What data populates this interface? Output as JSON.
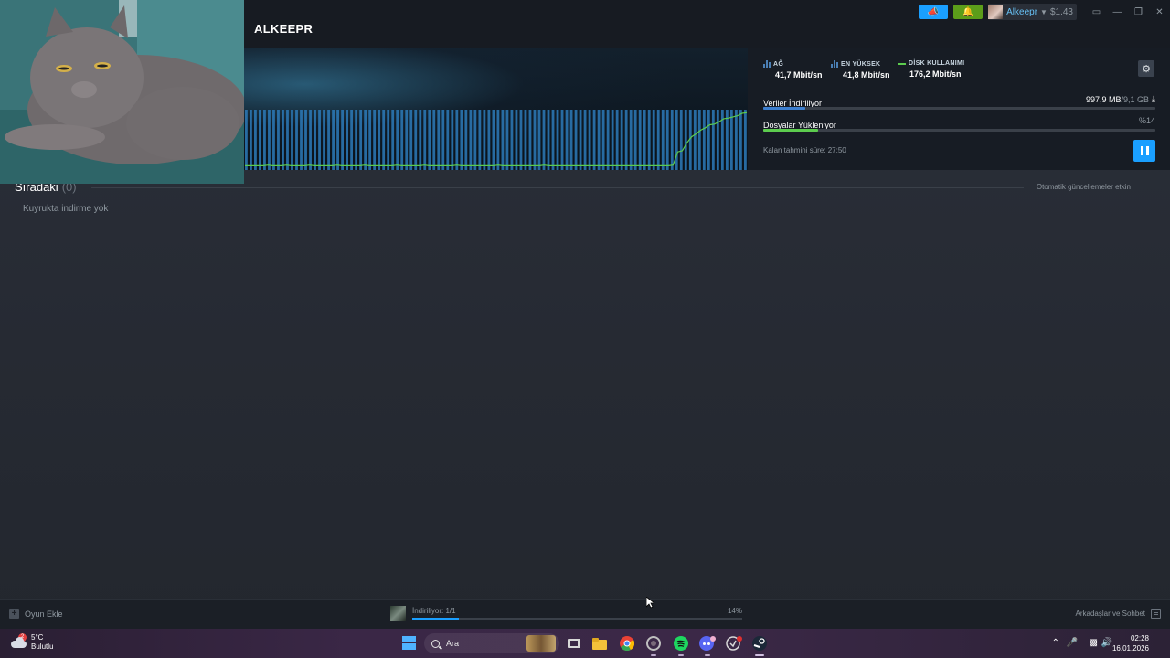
{
  "window": {
    "title": "ALKEEPR",
    "account": {
      "name": "Alkeepr",
      "balance": "$1.43"
    }
  },
  "stats": {
    "network": {
      "label": "AĞ",
      "value": "41,7 Mbit/sn"
    },
    "peak": {
      "label": "EN YÜKSEK",
      "value": "41,8 Mbit/sn"
    },
    "disk": {
      "label": "DİSK KULLANIMI",
      "value": "176,2 Mbit/sn"
    }
  },
  "progress": {
    "downloading_label": "Veriler İndiriliyor",
    "downloaded": "997,9 MB",
    "total": "/9,1 GB",
    "downloading_fraction": 0.107,
    "installing_label": "Dosyalar Yükleniyor",
    "installing_percent": "%14",
    "installing_fraction": 0.14,
    "eta": "Kalan tahmini süre: 27:50"
  },
  "graph": {
    "bar_count": 110,
    "disk_usage_series": [
      0.07,
      0.07,
      0.07,
      0.07,
      0.07,
      0.08,
      0.07,
      0.07,
      0.07,
      0.08,
      0.07,
      0.07,
      0.07,
      0.07,
      0.08,
      0.07,
      0.07,
      0.07,
      0.07,
      0.07,
      0.08,
      0.07,
      0.07,
      0.07,
      0.07,
      0.07,
      0.08,
      0.07,
      0.07,
      0.07,
      0.07,
      0.07,
      0.07,
      0.08,
      0.07,
      0.07,
      0.07,
      0.07,
      0.07,
      0.08,
      0.07,
      0.07,
      0.07,
      0.07,
      0.07,
      0.07,
      0.08,
      0.07,
      0.07,
      0.07,
      0.07,
      0.07,
      0.07,
      0.07,
      0.07,
      0.08,
      0.07,
      0.07,
      0.07,
      0.07,
      0.07,
      0.07,
      0.07,
      0.07,
      0.07,
      0.08,
      0.07,
      0.07,
      0.07,
      0.07,
      0.07,
      0.07,
      0.07,
      0.07,
      0.07,
      0.07,
      0.07,
      0.07,
      0.07,
      0.07,
      0.07,
      0.07,
      0.07,
      0.07,
      0.07,
      0.07,
      0.07,
      0.07,
      0.07,
      0.07,
      0.07,
      0.07,
      0.07,
      0.08,
      0.3,
      0.32,
      0.45,
      0.55,
      0.6,
      0.66,
      0.7,
      0.75,
      0.76,
      0.8,
      0.85,
      0.86,
      0.88,
      0.9,
      0.94,
      0.95
    ]
  },
  "queue": {
    "title": "Sıradaki",
    "count": "(0)",
    "auto_updates": "Otomatik güncellemeler etkin",
    "empty_text": "Kuyrukta indirme yok"
  },
  "bottombar": {
    "add_game": "Oyun Ekle",
    "download_status": "İndiriliyor: 1/1",
    "download_percent": "14%",
    "download_fraction": 0.14,
    "friends_chat": "Arkadaşlar ve Sohbet"
  },
  "taskbar": {
    "weather_temp": "5°C",
    "weather_condition": "Bulutlu",
    "weather_badge": "2",
    "search_placeholder": "Ara",
    "time": "02:28",
    "date": "16.01.2026"
  }
}
